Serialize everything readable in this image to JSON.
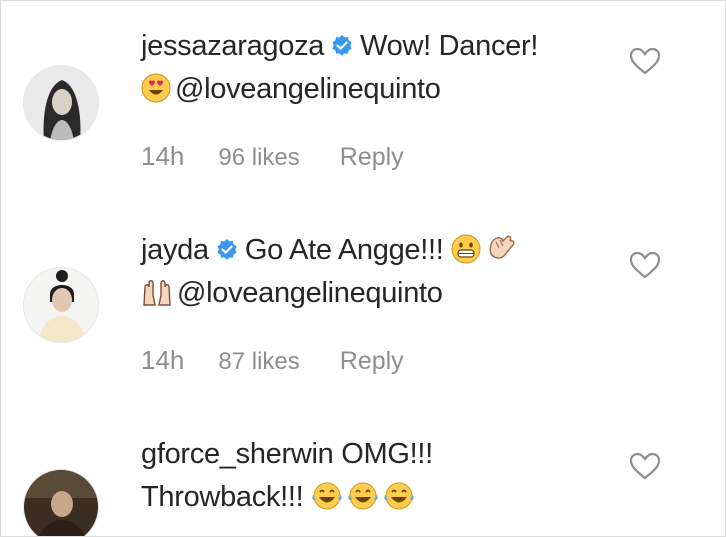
{
  "comments": [
    {
      "username": "jessazaragoza",
      "verified": true,
      "text": "Wow! Dancer!",
      "emojis_line2": [
        "heart-eyes-emoji"
      ],
      "mention": "@loveangelinequinto",
      "time": "14h",
      "likes": "96 likes",
      "reply": "Reply"
    },
    {
      "username": "jayda",
      "verified": true,
      "text": "Go Ate Angge!!!",
      "emojis_line1": [
        "grimace-emoji",
        "clapping-hands-emoji"
      ],
      "emojis_line2": [
        "raised-hands-emoji"
      ],
      "mention": "@loveangelinequinto",
      "time": "14h",
      "likes": "87 likes",
      "reply": "Reply"
    },
    {
      "username": "gforce_sherwin",
      "verified": false,
      "text": "OMG!!!",
      "text_line2": "Throwback!!!",
      "emojis_line2": [
        "tears-of-joy-emoji",
        "tears-of-joy-emoji",
        "tears-of-joy-emoji"
      ]
    }
  ],
  "colors": {
    "text": "#262626",
    "meta": "#8e8e8e",
    "verified_blue": "#3897f0",
    "border": "#dbdbdb"
  }
}
